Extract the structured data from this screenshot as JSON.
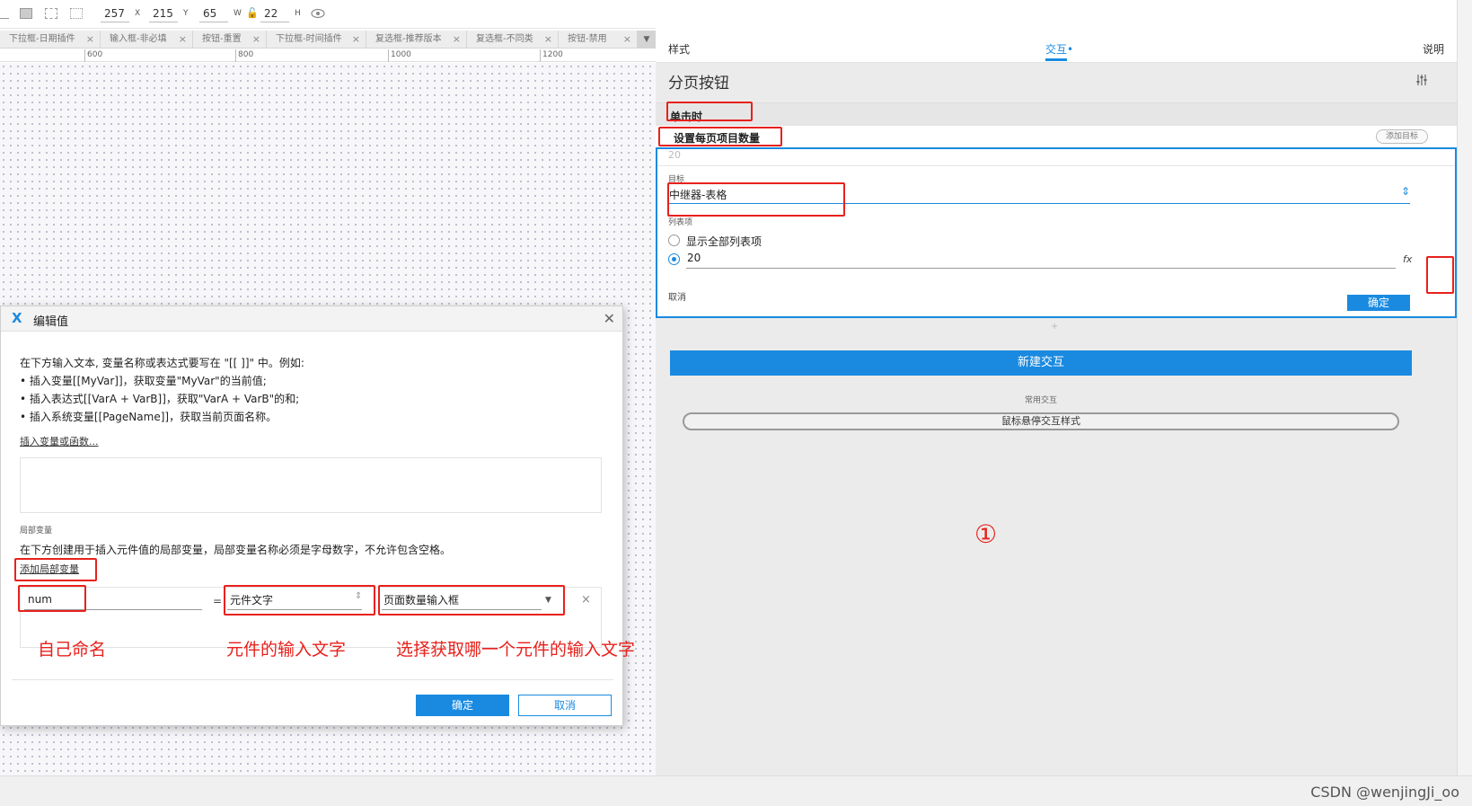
{
  "toolbar": {
    "x_value": "257",
    "x_label": "X",
    "y_value": "215",
    "y_label": "Y",
    "w_value": "65",
    "w_label": "W",
    "h_value": "22",
    "h_label": "H"
  },
  "tabs": [
    {
      "label": "下拉框-日期插件"
    },
    {
      "label": "输入框-非必填"
    },
    {
      "label": "按钮-重置"
    },
    {
      "label": "下拉框-时间插件"
    },
    {
      "label": "复选框-推荐版本"
    },
    {
      "label": "复选框-不同类"
    },
    {
      "label": "按钮-禁用"
    }
  ],
  "tab_close_glyph": "×",
  "tab_dropdown_glyph": "▼",
  "ruler": [
    "600",
    "800",
    "1000",
    "1200"
  ],
  "panel": {
    "tab_style": "样式",
    "tab_interaction": "交互•",
    "tab_notes": "说明",
    "widget_title": "分页按钮",
    "event": "单击时",
    "action": "设置每页项目数量",
    "add_target": "添加目标",
    "value_placeholder": "20",
    "target_label": "目标",
    "target_value": "中继器-表格",
    "list_label": "列表项",
    "radio_show_all": "显示全部列表项",
    "radio_count": "20",
    "fx": "fx",
    "cancel": "取消",
    "confirm": "确定",
    "plus": "+",
    "new_interaction": "新建交互",
    "common_label": "常用交互",
    "hover_style": "鼠标悬停交互样式",
    "circle_num": "①"
  },
  "dialog": {
    "title": "编辑值",
    "logo": "X",
    "close": "✕",
    "line1": "在下方输入文本, 变量名称或表达式要写在 \"[[ ]]\" 中。例如:",
    "line2": "• 插入变量[[MyVar]]，获取变量\"MyVar\"的当前值;",
    "line3": "• 插入表达式[[VarA + VarB]]，获取\"VarA + VarB\"的和;",
    "line4": "• 插入系统变量[[PageName]]，获取当前页面名称。",
    "insert_link": "插入变量或函数...",
    "local_label": "局部变量",
    "local_desc": "在下方创建用于插入元件值的局部变量，局部变量名称必须是字母数字，不允许包含空格。",
    "add_local": "添加局部变量",
    "var_name": "num",
    "equals": "=",
    "var_type": "元件文字",
    "var_widget": "页面数量输入框",
    "remove": "×",
    "ok": "确定",
    "cancel": "取消"
  },
  "annotations": {
    "own_name": "自己命名",
    "input_text": "元件的输入文字",
    "choose_widget": "选择获取哪一个元件的输入文字"
  },
  "watermark": "CSDN @wenjingJi_oo",
  "colors": {
    "accent": "#1a8ae0",
    "annotation": "#e8211c"
  }
}
